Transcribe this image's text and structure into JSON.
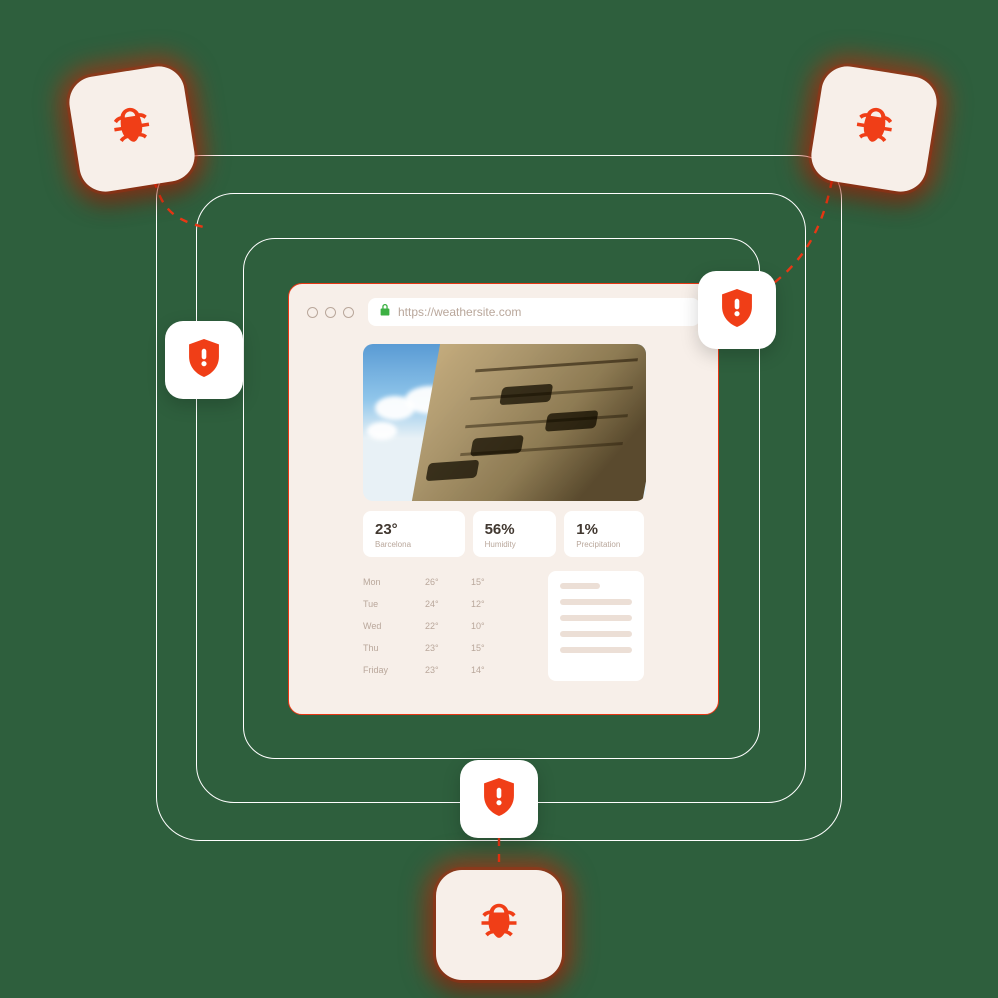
{
  "browser": {
    "url": "https://weathersite.com"
  },
  "weather": {
    "temp": {
      "value": "23°",
      "label": "Barcelona"
    },
    "humidity": {
      "value": "56%",
      "label": "Humidity"
    },
    "precip": {
      "value": "1%",
      "label": "Precipitation"
    },
    "forecast": [
      {
        "day": "Mon",
        "hi": "26°",
        "lo": "15°"
      },
      {
        "day": "Tue",
        "hi": "24°",
        "lo": "12°"
      },
      {
        "day": "Wed",
        "hi": "22°",
        "lo": "10°"
      },
      {
        "day": "Thu",
        "hi": "23°",
        "lo": "15°"
      },
      {
        "day": "Friday",
        "hi": "23°",
        "lo": "14°"
      }
    ]
  }
}
